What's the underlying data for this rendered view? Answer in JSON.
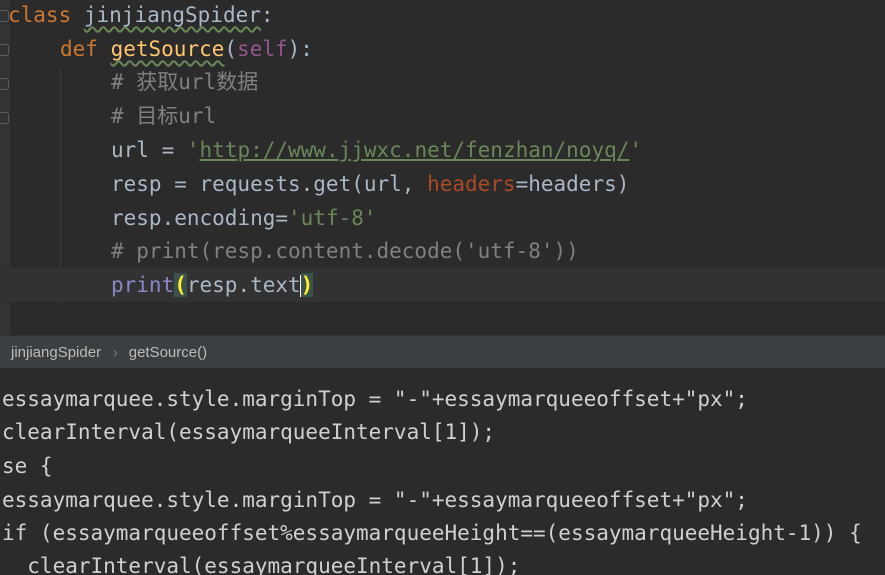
{
  "editor": {
    "lines": [
      {
        "indent": "",
        "class_kw": "class",
        "class_name": "jinjiangSpider",
        "colon": ":"
      },
      {
        "indent": "    ",
        "def_kw": "def",
        "func_name": "getSource",
        "open": "(",
        "self": "self",
        "close": "):"
      },
      {
        "indent": "        ",
        "comment": "# 获取url数据"
      },
      {
        "indent": "        ",
        "comment": "# 目标url"
      },
      {
        "indent": "        ",
        "lhs": "url = ",
        "q1": "'",
        "url": "http://www.jjwxc.net/fenzhan/noyq/",
        "q2": "'"
      },
      {
        "indent": "        ",
        "p1": "resp = requests.get(url, ",
        "param": "headers",
        "p2": "=headers)"
      },
      {
        "indent": "        ",
        "p1": "resp.encoding=",
        "str": "'utf-8'"
      },
      {
        "indent": "        ",
        "comment": "# print(resp.content.decode('utf-8'))"
      },
      {
        "indent": "        ",
        "builtin": "print",
        "paren_open": "(",
        "mid": "resp.",
        "attr": "text",
        "paren_close": ")"
      }
    ]
  },
  "breadcrumb": {
    "items": [
      "jinjiangSpider",
      "getSource()"
    ],
    "separator": "›"
  },
  "console": {
    "lines": [
      "essaymarquee.style.marginTop = \"-\"+essaymarqueeoffset+\"px\";",
      "clearInterval(essaymarqueeInterval[1]);",
      "se {",
      "essaymarquee.style.marginTop = \"-\"+essaymarqueeoffset+\"px\";",
      "if (essaymarqueeoffset%essaymarqueeHeight==(essaymarqueeHeight-1)) {",
      "  clearInterval(essaymarqueeInterval[1]);"
    ]
  },
  "colors": {
    "background": "#2b2b2b",
    "keyword": "#cc7832",
    "function": "#ffc66d",
    "comment": "#808080",
    "string": "#6a8759",
    "self": "#94558d",
    "param": "#aa4926"
  }
}
